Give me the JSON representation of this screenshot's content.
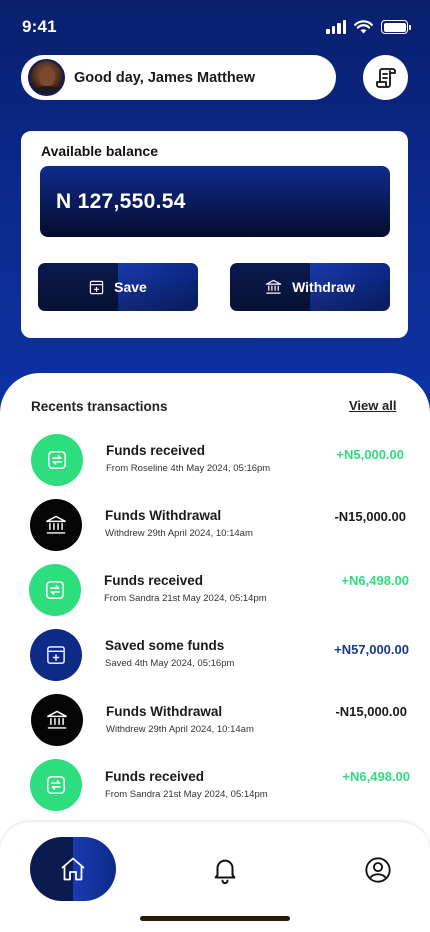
{
  "status_bar": {
    "time": "9:41"
  },
  "header": {
    "greeting": "Good day, James Matthew",
    "avatar_icon": "user-avatar",
    "receipt_icon": "receipt-icon"
  },
  "balance": {
    "label": "Available balance",
    "amount": "N 127,550.54",
    "save_label": "Save",
    "withdraw_label": "Withdraw"
  },
  "transactions": {
    "title": "Recents transactions",
    "view_all": "View all",
    "items": [
      {
        "title": "Funds received",
        "subtitle": "From Roseline 4th May 2024, 05:16pm",
        "amount": "+N5,000.00",
        "type": "received"
      },
      {
        "title": "Funds Withdrawal",
        "subtitle": "Withdrew 29th April 2024, 10:14am",
        "amount": "-N15,000.00",
        "type": "withdrawal"
      },
      {
        "title": "Funds received",
        "subtitle": "From Sandra  21st May 2024, 05:14pm",
        "amount": "+N6,498.00",
        "type": "received"
      },
      {
        "title": "Saved some funds",
        "subtitle": "Saved 4th May 2024, 05:16pm",
        "amount": "+N57,000.00",
        "type": "saved"
      },
      {
        "title": "Funds Withdrawal",
        "subtitle": "Withdrew 29th April 2024, 10:14am",
        "amount": "-N15,000.00",
        "type": "withdrawal"
      },
      {
        "title": "Funds received",
        "subtitle": "From Sandra  21st May 2024, 05:14pm",
        "amount": "+N6,498.00",
        "type": "received"
      }
    ]
  },
  "nav": {
    "items": [
      "home-icon",
      "bell-icon",
      "profile-icon"
    ]
  },
  "colors": {
    "primary_blue": "#0b2a8e",
    "green": "#2ede7e",
    "dark": "#050505"
  }
}
